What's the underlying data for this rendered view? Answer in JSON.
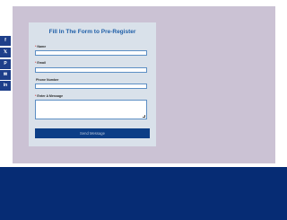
{
  "form": {
    "title": "Fill In The Form to Pre-Register",
    "fields": [
      {
        "label": "Name",
        "required": "*",
        "value": ""
      },
      {
        "label": "Email",
        "required": "*",
        "value": ""
      },
      {
        "label": "Phone Number",
        "required": "",
        "value": ""
      },
      {
        "label": "Enter A Message",
        "required": "*",
        "value": ""
      }
    ],
    "submit_label": "Send Message"
  },
  "share": {
    "items": [
      {
        "icon": "facebook-icon",
        "glyph": "f",
        "color": "#1e3f8a"
      },
      {
        "icon": "x-icon",
        "glyph": "𝕏",
        "color": "#1e3f8a"
      },
      {
        "icon": "pinterest-icon",
        "glyph": "P",
        "color": "#1e3f8a"
      },
      {
        "icon": "email-icon",
        "glyph": "✉",
        "color": "#1e3f8a"
      },
      {
        "icon": "linkedin-icon",
        "glyph": "in",
        "color": "#1e3f8a"
      }
    ]
  },
  "colors": {
    "panel": "#cbc2d4",
    "card": "#d9e1ea",
    "title": "#1f5fa8",
    "button": "#0c3e86",
    "footer": "#062c74"
  }
}
